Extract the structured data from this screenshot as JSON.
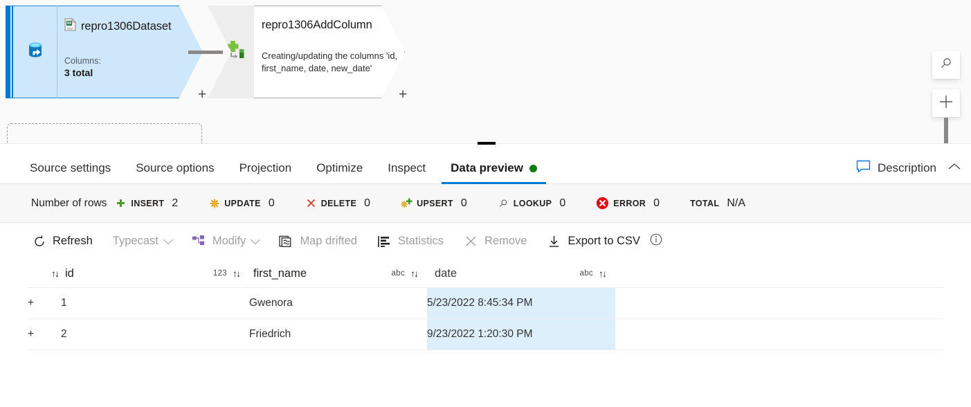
{
  "canvas": {
    "source_node": {
      "name": "repro1306Dataset",
      "dataset_icon": "csv-file-icon",
      "source_icon": "database-source-icon",
      "sub_label": "Columns:",
      "sub_value": "3 total",
      "add_label": "+"
    },
    "transform_node": {
      "name": "repro1306AddColumn",
      "icon": "derived-column-icon",
      "description": "Creating/updating the columns 'id, first_name, date, new_date'",
      "add_label": "+"
    },
    "controls": {
      "search_icon": "search-icon",
      "zoom_in_icon": "plus-icon"
    }
  },
  "panel": {
    "tabs": [
      {
        "label": "Source settings",
        "active": false
      },
      {
        "label": "Source options",
        "active": false
      },
      {
        "label": "Projection",
        "active": false
      },
      {
        "label": "Optimize",
        "active": false
      },
      {
        "label": "Inspect",
        "active": false
      },
      {
        "label": "Data preview",
        "active": true
      }
    ],
    "description_button": "Description",
    "collapse_icon": "chevron-up-icon",
    "stats": {
      "row_label": "Number of rows",
      "items": [
        {
          "icon": "plus-green-icon",
          "name": "INSERT",
          "value": "2"
        },
        {
          "icon": "asterisk-gold-icon",
          "name": "UPDATE",
          "value": "0"
        },
        {
          "icon": "x-red-icon",
          "name": "DELETE",
          "value": "0"
        },
        {
          "icon": "upsert-icon",
          "name": "UPSERT",
          "value": "0"
        },
        {
          "icon": "magnifier-icon",
          "name": "LOOKUP",
          "value": "0"
        },
        {
          "icon": "error-circle-icon",
          "name": "ERROR",
          "value": "0"
        },
        {
          "icon": "none",
          "name": "TOTAL",
          "value": "N/A"
        }
      ]
    },
    "toolbar": [
      {
        "label": "Refresh",
        "icon": "refresh-icon",
        "disabled": false,
        "caret": false
      },
      {
        "label": "Typecast",
        "icon": "none",
        "disabled": true,
        "caret": true
      },
      {
        "label": "Modify",
        "icon": "modify-icon",
        "disabled": true,
        "caret": true
      },
      {
        "label": "Map drifted",
        "icon": "map-drifted-icon",
        "disabled": true,
        "caret": false
      },
      {
        "label": "Statistics",
        "icon": "statistics-icon",
        "disabled": true,
        "caret": false
      },
      {
        "label": "Remove",
        "icon": "remove-x-icon",
        "disabled": true,
        "caret": false
      },
      {
        "label": "Export to CSV",
        "icon": "download-icon",
        "disabled": false,
        "caret": false
      }
    ],
    "toolbar_info_icon": "info-icon",
    "table": {
      "columns": [
        {
          "name": "id",
          "type": "123",
          "sort_icon": "sort-updown-icon",
          "highlighted": false
        },
        {
          "name": "first_name",
          "type": "abc",
          "sort_icon": "sort-updown-icon",
          "highlighted": false
        },
        {
          "name": "date",
          "type": "abc",
          "sort_icon": "sort-updown-icon",
          "highlighted": true
        }
      ],
      "rows": [
        {
          "marker": "+",
          "id": "1",
          "first_name": "Gwenora",
          "date": "5/23/2022 8:45:34 PM"
        },
        {
          "marker": "+",
          "id": "2",
          "first_name": "Friedrich",
          "date": "9/23/2022 1:20:30 PM"
        }
      ]
    }
  },
  "colors": {
    "accent": "#0078d4",
    "source_fill": "#cfe7fa",
    "insert_green": "#107c10",
    "error_red": "#e81123",
    "highlight_cell": "#deeffc"
  }
}
